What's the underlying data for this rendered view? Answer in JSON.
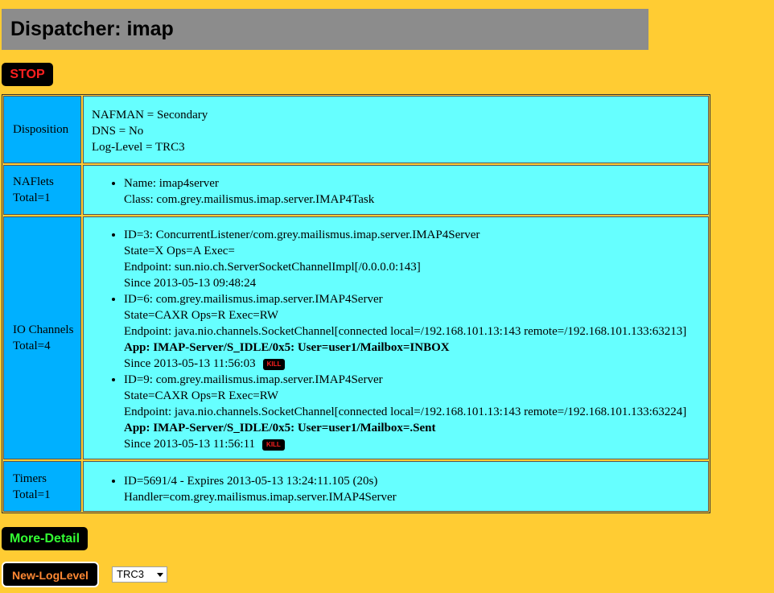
{
  "header": {
    "title": "Dispatcher: imap"
  },
  "buttons": {
    "stop": "STOP",
    "more_detail": "More-Detail",
    "new_loglevel": "New-LogLevel",
    "kill": "KILL"
  },
  "loglevel_select": {
    "selected": "TRC3"
  },
  "disposition": {
    "label": "Disposition",
    "lines": [
      "NAFMAN = Secondary",
      "DNS = No",
      "Log-Level = TRC3"
    ]
  },
  "naflets": {
    "label": "NAFlets",
    "total": "Total=1",
    "items": [
      {
        "name": "Name: imap4server",
        "class": "Class: com.grey.mailismus.imap.server.IMAP4Task"
      }
    ]
  },
  "io_channels": {
    "label": "IO Channels",
    "total": "Total=4",
    "items": [
      {
        "id": "ID=3: ConcurrentListener/com.grey.mailismus.imap.server.IMAP4Server",
        "state": "State=X Ops=A Exec=",
        "endpoint": "Endpoint: sun.nio.ch.ServerSocketChannelImpl[/0.0.0.0:143]",
        "since": "Since 2013-05-13 09:48:24"
      },
      {
        "id": "ID=6: com.grey.mailismus.imap.server.IMAP4Server",
        "state": "State=CAXR Ops=R Exec=RW",
        "endpoint": "Endpoint: java.nio.channels.SocketChannel[connected local=/192.168.101.13:143 remote=/192.168.101.133:63213]",
        "app": "App: IMAP-Server/S_IDLE/0x5: User=user1/Mailbox=INBOX",
        "since": "Since 2013-05-13 11:56:03"
      },
      {
        "id": "ID=9: com.grey.mailismus.imap.server.IMAP4Server",
        "state": "State=CAXR Ops=R Exec=RW",
        "endpoint": "Endpoint: java.nio.channels.SocketChannel[connected local=/192.168.101.13:143 remote=/192.168.101.133:63224]",
        "app": "App: IMAP-Server/S_IDLE/0x5: User=user1/Mailbox=.Sent",
        "since": "Since 2013-05-13 11:56:11"
      }
    ]
  },
  "timers": {
    "label": "Timers",
    "total": "Total=1",
    "items": [
      {
        "id": "ID=5691/4 - Expires 2013-05-13 13:24:11.105 (20s)",
        "handler": "Handler=com.grey.mailismus.imap.server.IMAP4Server"
      }
    ]
  },
  "colors": {
    "page_bg": "#FFCC33",
    "header_bg": "#8C8C8C",
    "label_bg": "#00B0FF",
    "value_bg": "#66FFFF",
    "stop_text": "#FF2020",
    "more_detail_text": "#33FF33",
    "new_loglevel_text": "#FF8833"
  }
}
